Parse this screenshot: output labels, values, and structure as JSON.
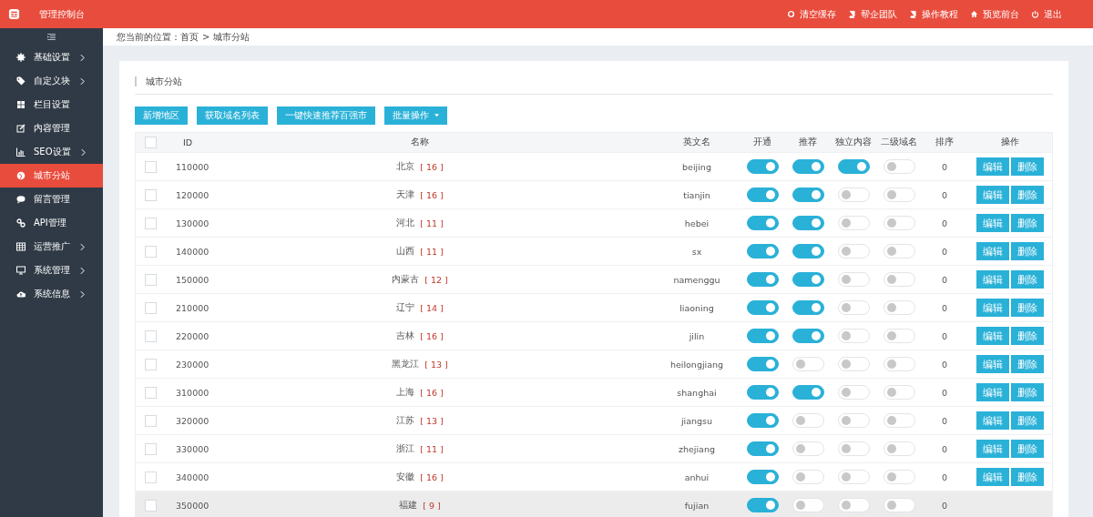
{
  "header": {
    "title": "管理控制台",
    "links": [
      "清空缓存",
      "帮企团队",
      "操作教程",
      "预览前台",
      "退出"
    ]
  },
  "sidebar": {
    "items": [
      {
        "label": "基础设置",
        "has_submenu": true,
        "selected": false
      },
      {
        "label": "自定义块",
        "has_submenu": true,
        "selected": false
      },
      {
        "label": "栏目设置",
        "has_submenu": false,
        "selected": false
      },
      {
        "label": "内容管理",
        "has_submenu": false,
        "selected": false
      },
      {
        "label": "SEO设置",
        "has_submenu": true,
        "selected": false
      },
      {
        "label": "城市分站",
        "has_submenu": false,
        "selected": true
      },
      {
        "label": "留言管理",
        "has_submenu": false,
        "selected": false
      },
      {
        "label": "API管理",
        "has_submenu": false,
        "selected": false
      },
      {
        "label": "运营推广",
        "has_submenu": true,
        "selected": false
      },
      {
        "label": "系统管理",
        "has_submenu": true,
        "selected": false
      },
      {
        "label": "系统信息",
        "has_submenu": true,
        "selected": false
      }
    ]
  },
  "breadcrumb": {
    "label": "您当前的位置：",
    "items": [
      "首页",
      "城市分站"
    ],
    "separator": ">"
  },
  "panel": {
    "title": "城市分站",
    "buttons": [
      {
        "label": "新增地区",
        "dropdown": false
      },
      {
        "label": "获取域名列表",
        "dropdown": false
      },
      {
        "label": "一键快速推荐百强市",
        "dropdown": false
      },
      {
        "label": "批量操作",
        "dropdown": true
      }
    ],
    "table": {
      "all_checked": false,
      "columns": [
        "ID",
        "名称",
        "英文名",
        "开通",
        "推荐",
        "独立内容",
        "二级域名",
        "排序",
        "操作"
      ],
      "rows": [
        {
          "id": "110000",
          "name": "北京",
          "count": "[ 16 ]",
          "english": "beijing",
          "open": true,
          "recommend": true,
          "independent": true,
          "subdomain": false,
          "sort": "0",
          "checked": false,
          "hovered": false,
          "actions": [
            "编辑",
            "删除"
          ]
        },
        {
          "id": "120000",
          "name": "天津",
          "count": "[ 16 ]",
          "english": "tianjin",
          "open": true,
          "recommend": true,
          "independent": false,
          "subdomain": false,
          "sort": "0",
          "checked": false,
          "hovered": false,
          "actions": [
            "编辑",
            "删除"
          ]
        },
        {
          "id": "130000",
          "name": "河北",
          "count": "[ 11 ]",
          "english": "hebei",
          "open": true,
          "recommend": true,
          "independent": false,
          "subdomain": false,
          "sort": "0",
          "checked": false,
          "hovered": false,
          "actions": [
            "编辑",
            "删除"
          ]
        },
        {
          "id": "140000",
          "name": "山西",
          "count": "[ 11 ]",
          "english": "sx",
          "open": true,
          "recommend": true,
          "independent": false,
          "subdomain": false,
          "sort": "0",
          "checked": false,
          "hovered": false,
          "actions": [
            "编辑",
            "删除"
          ]
        },
        {
          "id": "150000",
          "name": "内蒙古",
          "count": "[ 12 ]",
          "english": "namenggu",
          "open": true,
          "recommend": true,
          "independent": false,
          "subdomain": false,
          "sort": "0",
          "checked": false,
          "hovered": false,
          "actions": [
            "编辑",
            "删除"
          ]
        },
        {
          "id": "210000",
          "name": "辽宁",
          "count": "[ 14 ]",
          "english": "liaoning",
          "open": true,
          "recommend": true,
          "independent": false,
          "subdomain": false,
          "sort": "0",
          "checked": false,
          "hovered": false,
          "actions": [
            "编辑",
            "删除"
          ]
        },
        {
          "id": "220000",
          "name": "吉林",
          "count": "[ 16 ]",
          "english": "jilin",
          "open": true,
          "recommend": true,
          "independent": false,
          "subdomain": false,
          "sort": "0",
          "checked": false,
          "hovered": false,
          "actions": [
            "编辑",
            "删除"
          ]
        },
        {
          "id": "230000",
          "name": "黑龙江",
          "count": "[ 13 ]",
          "english": "heilongjiang",
          "open": true,
          "recommend": false,
          "independent": false,
          "subdomain": false,
          "sort": "0",
          "checked": false,
          "hovered": false,
          "actions": [
            "编辑",
            "删除"
          ]
        },
        {
          "id": "310000",
          "name": "上海",
          "count": "[ 16 ]",
          "english": "shanghai",
          "open": true,
          "recommend": true,
          "independent": false,
          "subdomain": false,
          "sort": "0",
          "checked": false,
          "hovered": false,
          "actions": [
            "编辑",
            "删除"
          ]
        },
        {
          "id": "320000",
          "name": "江苏",
          "count": "[ 13 ]",
          "english": "jiangsu",
          "open": true,
          "recommend": false,
          "independent": false,
          "subdomain": false,
          "sort": "0",
          "checked": false,
          "hovered": false,
          "actions": [
            "编辑",
            "删除"
          ]
        },
        {
          "id": "330000",
          "name": "浙江",
          "count": "[ 11 ]",
          "english": "zhejiang",
          "open": true,
          "recommend": false,
          "independent": false,
          "subdomain": false,
          "sort": "0",
          "checked": false,
          "hovered": false,
          "actions": [
            "编辑",
            "删除"
          ]
        },
        {
          "id": "340000",
          "name": "安徽",
          "count": "[ 16 ]",
          "english": "anhui",
          "open": true,
          "recommend": false,
          "independent": false,
          "subdomain": false,
          "sort": "0",
          "checked": false,
          "hovered": false,
          "actions": [
            "编辑",
            "删除"
          ]
        },
        {
          "id": "350000",
          "name": "福建",
          "count": "[ 9 ]",
          "english": "fujian",
          "open": true,
          "recommend": false,
          "independent": false,
          "subdomain": false,
          "sort": "0",
          "checked": false,
          "hovered": true,
          "actions": []
        }
      ]
    }
  }
}
